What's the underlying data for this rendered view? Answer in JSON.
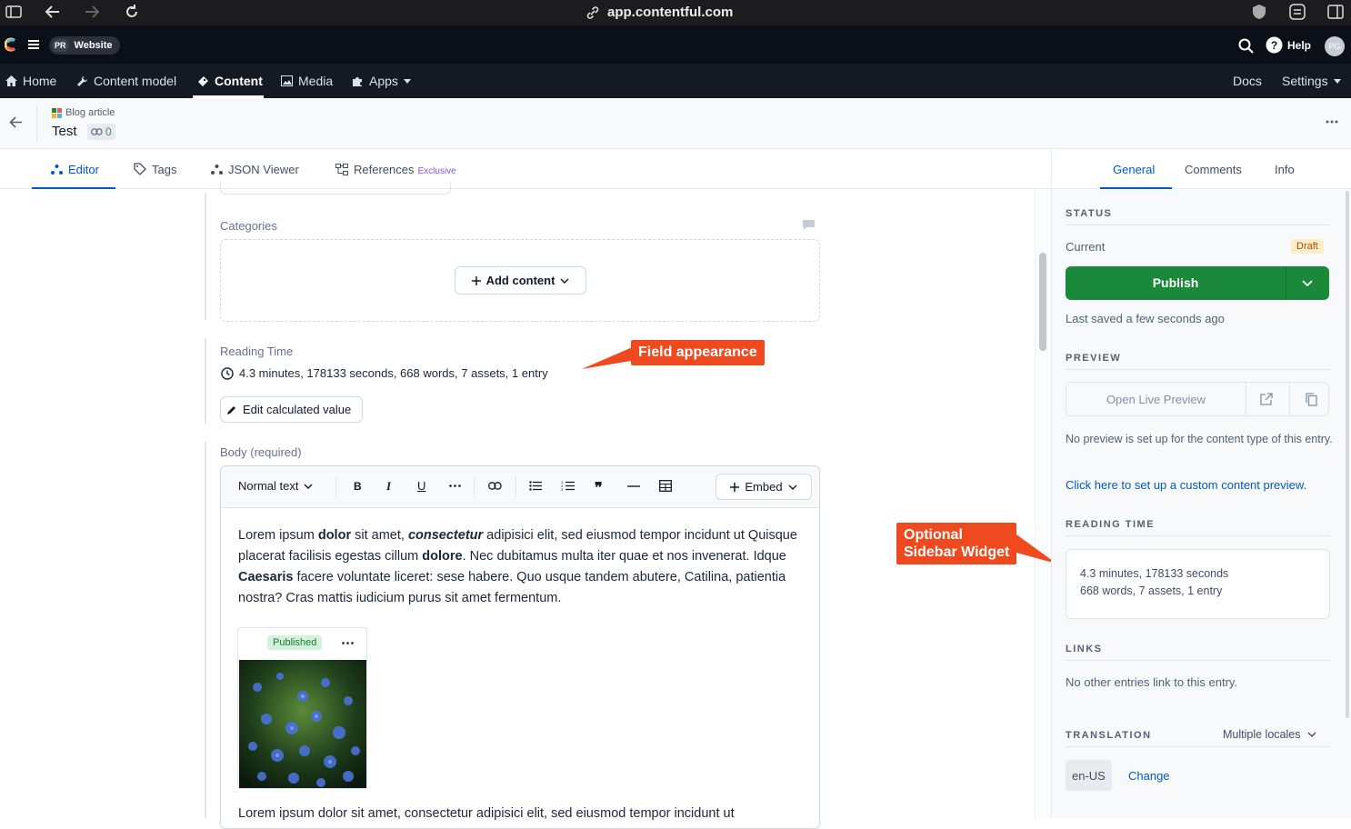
{
  "browser": {
    "url": "app.contentful.com"
  },
  "appbar": {
    "space_initials": "PR",
    "space_name": "Website",
    "help_label": "Help",
    "avatar_initials": "PG"
  },
  "nav": {
    "home": "Home",
    "content_model": "Content model",
    "content": "Content",
    "media": "Media",
    "apps": "Apps",
    "docs": "Docs",
    "settings": "Settings"
  },
  "entry": {
    "content_type": "Blog article",
    "title": "Test",
    "ref_count": "0"
  },
  "tabs": {
    "editor": "Editor",
    "tags": "Tags",
    "json_viewer": "JSON Viewer",
    "references": "References",
    "references_badge": "Exclusive"
  },
  "side_tabs": {
    "general": "General",
    "comments": "Comments",
    "info": "Info"
  },
  "fields": {
    "categories_label": "Categories",
    "add_content_label": "Add content",
    "reading_time_label": "Reading Time",
    "reading_time_value": "4.3 minutes, 178133 seconds, 668 words, 7 assets, 1 entry",
    "edit_calculated_label": "Edit calculated value",
    "body_label": "Body (required)"
  },
  "toolbar": {
    "format_select": "Normal text",
    "embed_label": "Embed"
  },
  "body": {
    "p1_a": "Lorem ipsum ",
    "p1_b": "dolor",
    "p1_c": " sit amet, ",
    "p1_d": "consectetur",
    "p1_e": " adipisici elit, sed eiusmod tempor incidunt ut Quisque placerat facilisis egestas cillum ",
    "p1_f": "dolore",
    "p1_g": ". Nec dubitamus multa iter quae et nos invenerat. Idque ",
    "p1_h": "Caesaris",
    "p1_i": " facere voluntate liceret: sese habere. Quo usque tandem abutere, Catilina, patientia nostra? Cras mattis iudicium purus sit amet fermentum.",
    "asset_status": "Published",
    "p2": "Lorem ipsum dolor sit amet, consectetur adipisici elit, sed eiusmod tempor incidunt ut"
  },
  "callouts": {
    "field_appearance": "Field appearance",
    "sidebar_widget_line1": "Optional",
    "sidebar_widget_line2": "Sidebar Widget"
  },
  "sidebar": {
    "status_header": "STATUS",
    "current_label": "Current",
    "status_badge": "Draft",
    "publish_label": "Publish",
    "last_saved": "Last saved a few seconds ago",
    "preview_header": "PREVIEW",
    "open_live_preview": "Open Live Preview",
    "preview_note": "No preview is set up for the content type of this entry.",
    "preview_link": "Click here to set up a custom content preview.",
    "reading_time_header": "READING TIME",
    "reading_time_line1": "4.3 minutes, 178133 seconds",
    "reading_time_line2": "668 words, 7 assets, 1 entry",
    "links_header": "LINKS",
    "links_note": "No other entries link to this entry.",
    "translation_header": "TRANSLATION",
    "locales_select": "Multiple locales",
    "locale_chip": "en-US",
    "change_label": "Change"
  },
  "colors": {
    "primary": "#0059c8",
    "publish": "#1a8a3a",
    "draft_bg": "#fdecc8",
    "callout": "#ef4a1f",
    "nav_bg": "#141a23"
  }
}
